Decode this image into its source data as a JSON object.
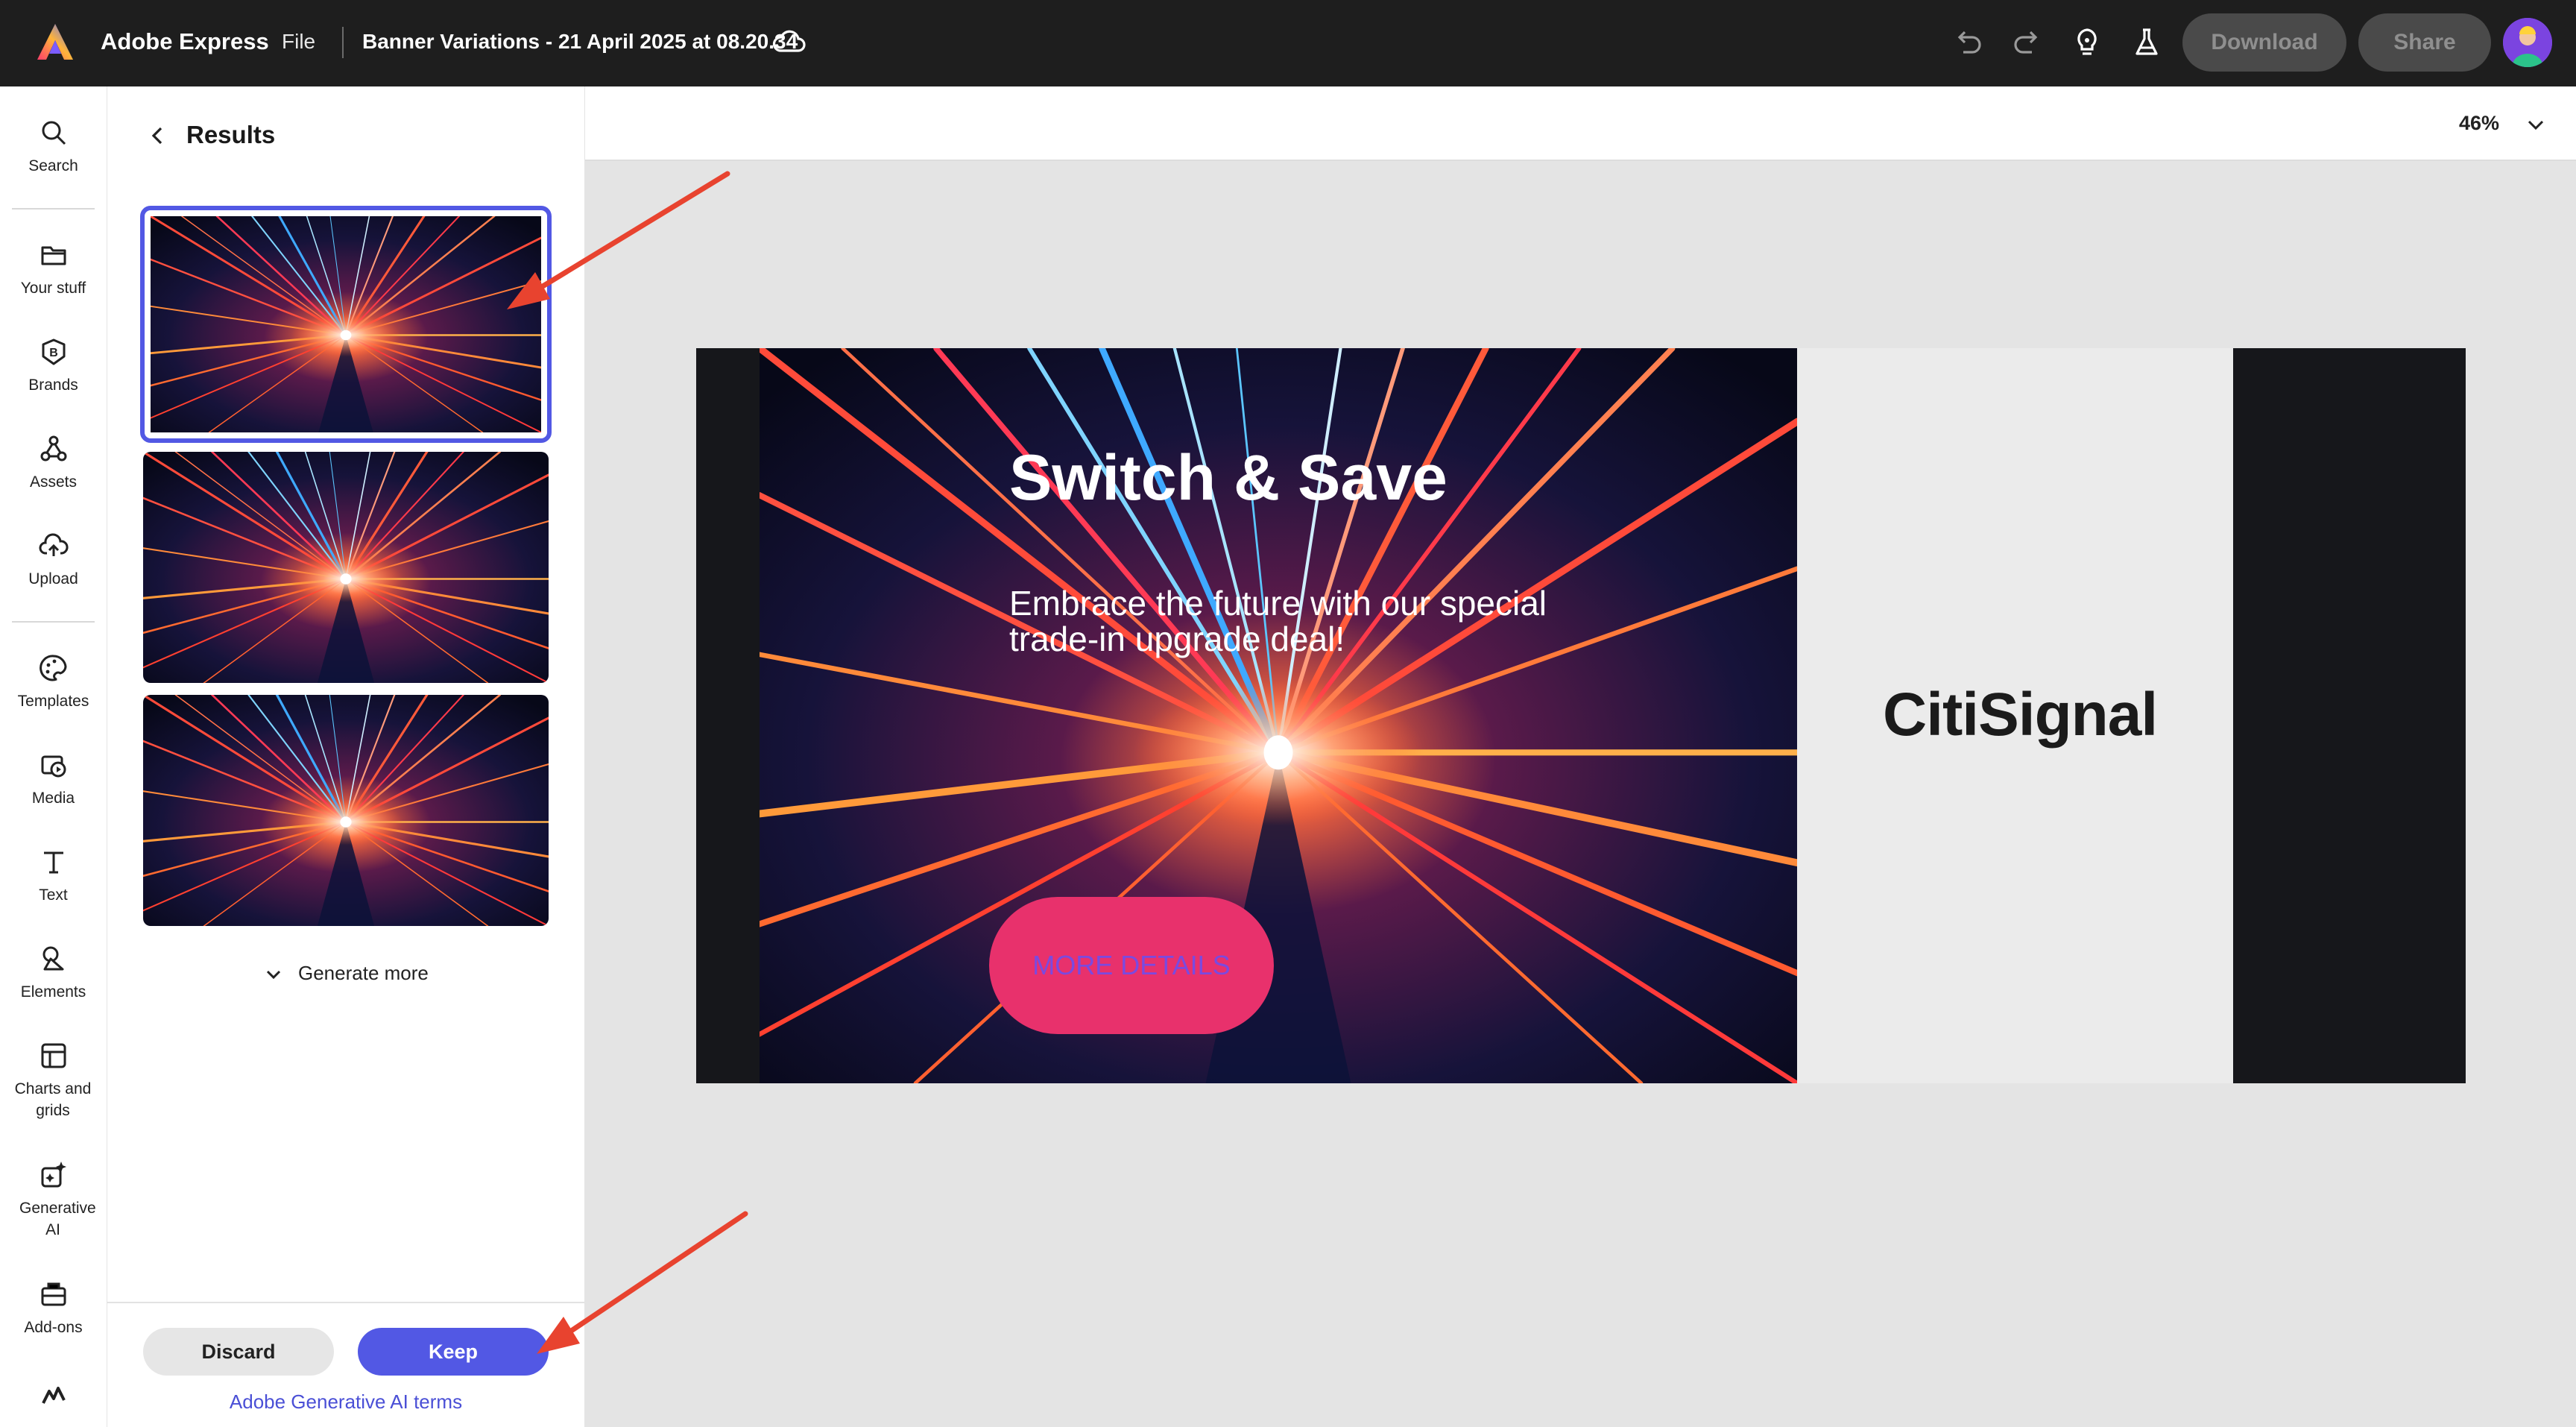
{
  "topbar": {
    "app_name": "Adobe Express",
    "menu_file": "File",
    "doc_title": "Banner Variations - 21 April 2025 at 08.20.34",
    "download_label": "Download",
    "share_label": "Share",
    "icons": [
      "adobe-express-logo",
      "cloud-icon",
      "undo-icon",
      "redo-icon",
      "lightbulb-icon",
      "flask-icon"
    ]
  },
  "rail": {
    "items": [
      {
        "label": "Search",
        "icon": "search-icon"
      },
      {
        "label": "Your stuff",
        "icon": "folder-icon"
      },
      {
        "label": "Brands",
        "icon": "brand-icon"
      },
      {
        "label": "Assets",
        "icon": "assets-icon"
      },
      {
        "label": "Upload",
        "icon": "upload-icon"
      },
      {
        "label": "Templates",
        "icon": "templates-icon"
      },
      {
        "label": "Media",
        "icon": "media-icon"
      },
      {
        "label": "Text",
        "icon": "text-icon"
      },
      {
        "label": "Elements",
        "icon": "elements-icon"
      },
      {
        "label": "Charts and grids",
        "icon": "charts-icon"
      },
      {
        "label": "Generative AI",
        "icon": "generative-ai-icon"
      },
      {
        "label": "Add-ons",
        "icon": "add-ons-icon"
      }
    ]
  },
  "panel": {
    "title": "Results",
    "generate_more": "Generate more",
    "discard_label": "Discard",
    "keep_label": "Keep",
    "terms_link": "Adobe Generative AI terms",
    "result_count": 3,
    "selected_result": 1
  },
  "canvas": {
    "zoom": "46%",
    "headline": "Switch & Save",
    "subtext": "Embrace the future with our special trade-in upgrade deal!",
    "cta_label": "MORE DETAILS",
    "brand": "CitiSignal"
  },
  "colors": {
    "accent": "#5258e4",
    "cta": "#e8316c",
    "topbar": "#1e1e1e",
    "annotation_arrow": "#e8432f"
  }
}
